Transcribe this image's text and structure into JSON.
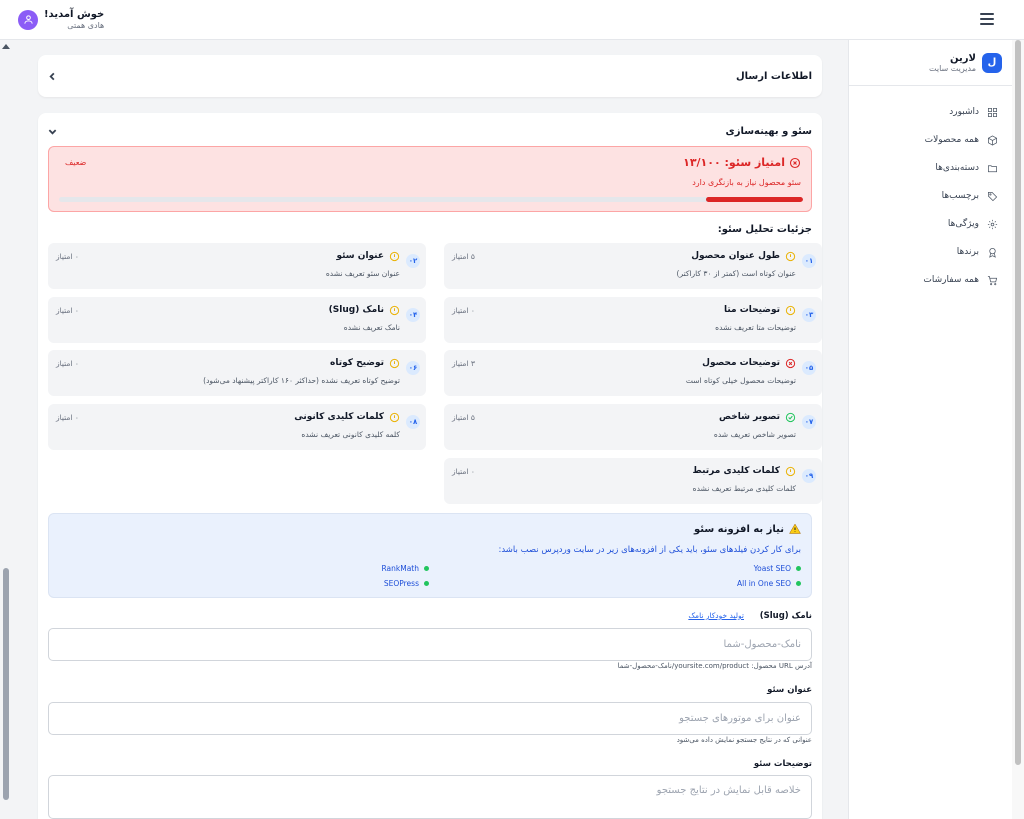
{
  "header": {
    "welcome": "خوش آمدید!",
    "user_name": "هادی همتی"
  },
  "sidebar": {
    "brand_logo": "ل",
    "brand_name": "لارین",
    "brand_sub": "مدیریت سایت",
    "items": [
      {
        "label": "داشبورد",
        "icon": "dashboard-icon"
      },
      {
        "label": "همه محصولات",
        "icon": "box-icon"
      },
      {
        "label": "دسته‌بندی‌ها",
        "icon": "folder-icon"
      },
      {
        "label": "برچسب‌ها",
        "icon": "tag-icon"
      },
      {
        "label": "ویژگی‌ها",
        "icon": "gear-icon"
      },
      {
        "label": "برندها",
        "icon": "award-icon"
      },
      {
        "label": "همه سفارشات",
        "icon": "cart-icon"
      }
    ]
  },
  "shipping_card": {
    "title": "اطلاعات ارسال"
  },
  "seo": {
    "title": "سئو و بهینه‌سازی",
    "score_label": "امتیاز سئو: ۱۳/۱۰۰",
    "score_value": 13,
    "score_max": 100,
    "score_badge": "ضعیف",
    "score_message": "سئو محصول نیاز به بازنگری دارد",
    "details_title": "جزئیات تحلیل سئو:",
    "items": [
      {
        "num": "۰۱",
        "title": "طول عنوان محصول",
        "desc": "عنوان کوتاه است (کمتر از ۳۰ کاراکتر)",
        "score": "۵ امتیاز",
        "status": "warning"
      },
      {
        "num": "۰۲",
        "title": "عنوان سئو",
        "desc": "عنوان سئو تعریف نشده",
        "score": "۰ امتیاز",
        "status": "warning"
      },
      {
        "num": "۰۳",
        "title": "توضیحات متا",
        "desc": "توضیحات متا تعریف نشده",
        "score": "۰ امتیاز",
        "status": "warning"
      },
      {
        "num": "۰۴",
        "title": "نامک (Slug)",
        "desc": "نامک تعریف نشده",
        "score": "۰ امتیاز",
        "status": "warning"
      },
      {
        "num": "۰۵",
        "title": "توضیحات محصول",
        "desc": "توضیحات محصول خیلی کوتاه است",
        "score": "۳ امتیاز",
        "status": "error"
      },
      {
        "num": "۰۶",
        "title": "توضیح کوتاه",
        "desc": "توضیح کوتاه تعریف نشده (حداکثر ۱۶۰ کاراکتر پیشنهاد می‌شود)",
        "score": "۰ امتیاز",
        "status": "warning"
      },
      {
        "num": "۰۷",
        "title": "تصویر شاخص",
        "desc": "تصویر شاخص تعریف شده",
        "score": "۵ امتیاز",
        "status": "success"
      },
      {
        "num": "۰۸",
        "title": "کلمات کلیدی کانونی",
        "desc": "کلمه کلیدی کانونی تعریف نشده",
        "score": "۰ امتیاز",
        "status": "warning"
      },
      {
        "num": "۰۹",
        "title": "کلمات کلیدی مرتبط",
        "desc": "کلمات کلیدی مرتبط تعریف نشده",
        "score": "۰ امتیاز",
        "status": "warning"
      }
    ],
    "plugin_notice": {
      "title": "نیاز به افزونه سئو",
      "desc": "برای کار کردن فیلدهای سئو، باید یکی از افزونه‌های زیر در سایت وردپرس نصب باشد:",
      "plugins": [
        "Yoast SEO",
        "RankMath",
        "All in One SEO",
        "SEOPress"
      ]
    },
    "slug": {
      "label": "نامک (Slug)",
      "link": "تولید خودکار نامک",
      "placeholder": "نامک-محصول-شما",
      "help": "آدرس URL محصول: yoursite.com/product/نامک-محصول-شما"
    },
    "seo_title": {
      "label": "عنوان سئو",
      "placeholder": "عنوان برای موتورهای جستجو",
      "help": "عنوانی که در نتایج جستجو نمایش داده می‌شود"
    },
    "seo_desc": {
      "label": "توضیحات سئو",
      "placeholder": "خلاصه قابل نمایش در نتایج جستجو"
    }
  },
  "colors": {
    "primary": "#2563eb",
    "danger": "#dc2626",
    "warning": "#eab308",
    "success": "#22c55e",
    "avatar": "#8b5cf6"
  }
}
